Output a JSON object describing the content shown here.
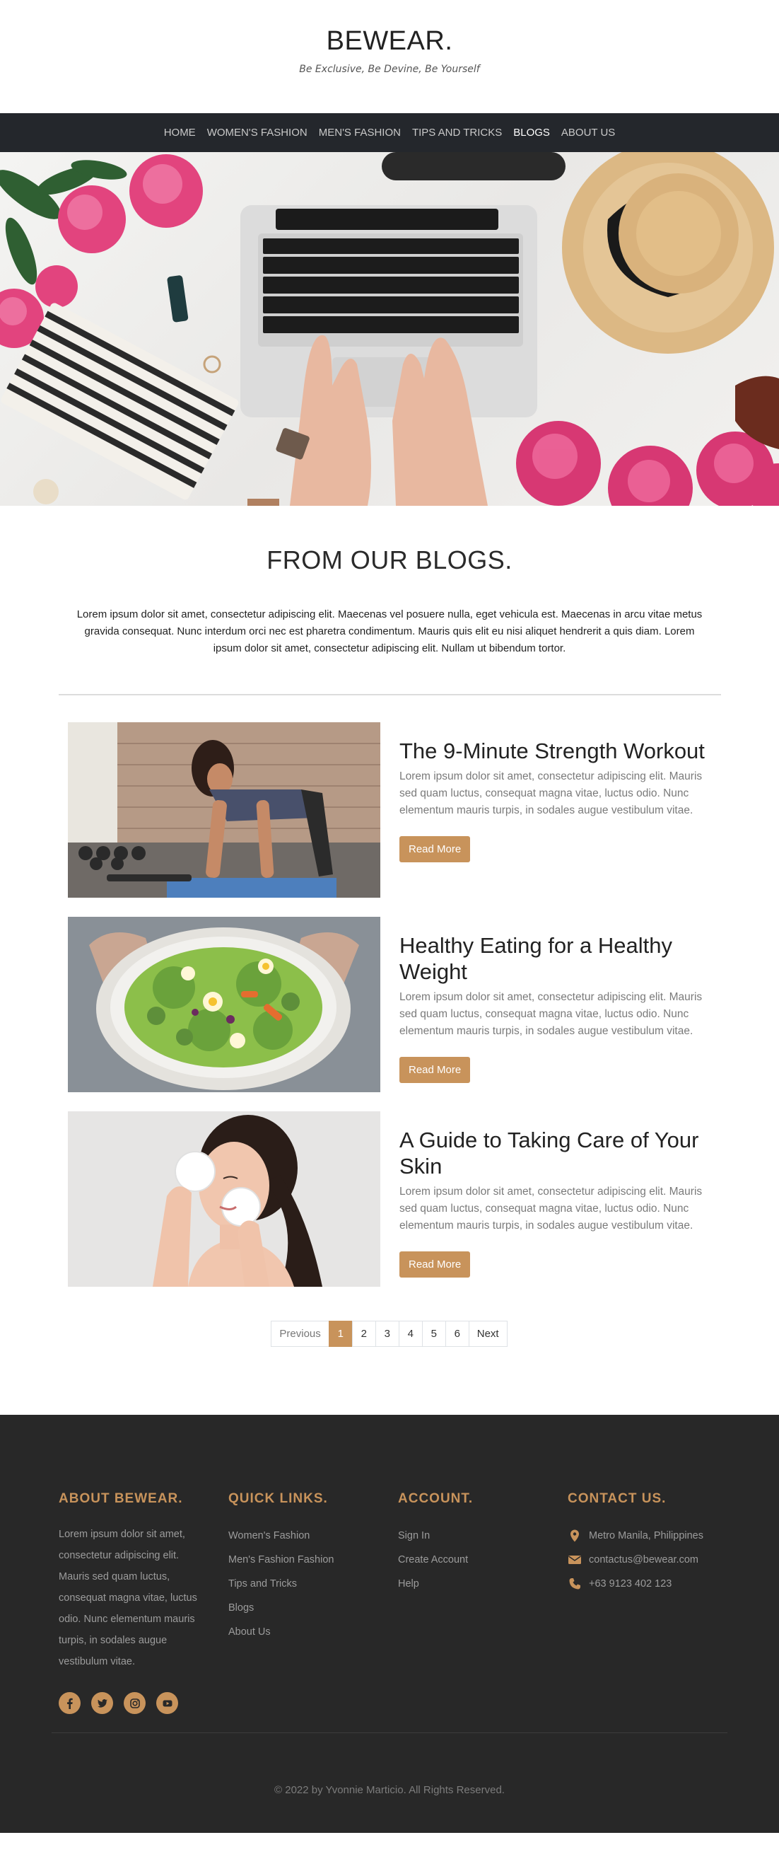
{
  "header": {
    "brand": "BEWEAR.",
    "tagline": "Be Exclusive, Be Devine, Be Yourself"
  },
  "nav": {
    "items": [
      {
        "label": "HOME"
      },
      {
        "label": "WOMEN'S FASHION"
      },
      {
        "label": "MEN'S FASHION"
      },
      {
        "label": "TIPS AND TRICKS"
      },
      {
        "label": "BLOGS"
      },
      {
        "label": "ABOUT US"
      }
    ],
    "active": "BLOGS"
  },
  "blogs": {
    "title": "FROM OUR BLOGS.",
    "intro": "Lorem ipsum dolor sit amet, consectetur adipiscing elit. Maecenas vel posuere nulla, eget vehicula est. Maecenas in arcu vitae metus gravida consequat. Nunc interdum orci nec est pharetra condimentum. Mauris quis elit eu nisi aliquet hendrerit a quis diam. Lorem ipsum dolor sit amet, consectetur adipiscing elit. Nullam ut bibendum tortor.",
    "posts": [
      {
        "title": "The 9-Minute Strength Workout",
        "excerpt": "Lorem ipsum dolor sit amet, consectetur adipiscing elit. Mauris sed quam luctus, consequat magna vitae, luctus odio. Nunc elementum mauris turpis, in sodales augue vestibulum vitae.",
        "button": "Read More"
      },
      {
        "title": "Healthy Eating for a Healthy Weight",
        "excerpt": "Lorem ipsum dolor sit amet, consectetur adipiscing elit. Mauris sed quam luctus, consequat magna vitae, luctus odio. Nunc elementum mauris turpis, in sodales augue vestibulum vitae.",
        "button": "Read More"
      },
      {
        "title": "A Guide to Taking Care of Your Skin",
        "excerpt": "Lorem ipsum dolor sit amet, consectetur adipiscing elit. Mauris sed quam luctus, consequat magna vitae, luctus odio. Nunc elementum mauris turpis, in sodales augue vestibulum vitae.",
        "button": "Read More"
      }
    ]
  },
  "pagination": {
    "previous": "Previous",
    "pages": [
      "1",
      "2",
      "3",
      "4",
      "5",
      "6"
    ],
    "current": "1",
    "next": "Next"
  },
  "footer": {
    "about": {
      "heading": "ABOUT BEWEAR.",
      "text": "Lorem ipsum dolor sit amet, consectetur adipiscing elit. Mauris sed quam luctus, consequat magna vitae, luctus odio. Nunc elementum mauris turpis, in sodales augue vestibulum vitae."
    },
    "quick_links": {
      "heading": "QUICK LINKS.",
      "items": [
        "Women's Fashion",
        "Men's Fashion Fashion",
        "Tips and Tricks",
        "Blogs",
        "About Us"
      ]
    },
    "account": {
      "heading": "ACCOUNT.",
      "items": [
        "Sign In",
        "Create Account",
        "Help"
      ]
    },
    "contact": {
      "heading": "CONTACT US.",
      "location": "Metro Manila, Philippines",
      "email": "contactus@bewear.com",
      "phone": "+63 9123 402 123"
    },
    "socials": [
      "facebook-icon",
      "twitter-icon",
      "instagram-icon",
      "youtube-icon"
    ],
    "copyright": "© 2022 by Yvonnie Marticio. All Rights Reserved."
  },
  "colors": {
    "accent": "#c8935b",
    "nav_bg": "#24272c",
    "footer_bg": "#282828"
  }
}
